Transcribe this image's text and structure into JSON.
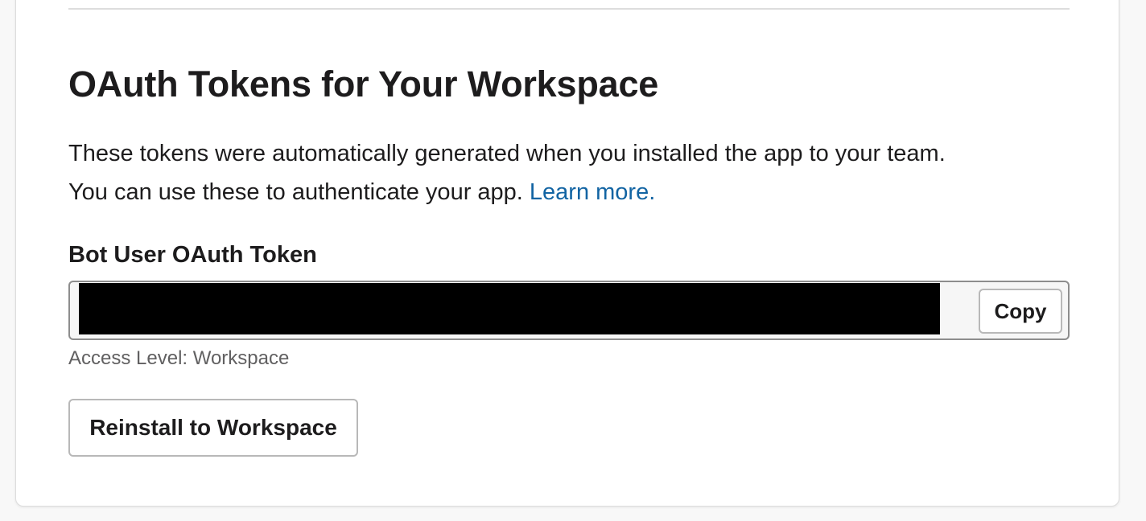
{
  "section": {
    "title": "OAuth Tokens for Your Workspace",
    "description_line1": "These tokens were automatically generated when you installed the app to your team.",
    "description_line2": "You can use these to authenticate your app.",
    "learn_more_label": "Learn more."
  },
  "token": {
    "label": "Bot User OAuth Token",
    "copy_label": "Copy",
    "access_level": "Access Level: Workspace"
  },
  "actions": {
    "reinstall_label": "Reinstall to Workspace"
  },
  "colors": {
    "link": "#1264a3",
    "text": "#1d1c1d",
    "muted": "#616061"
  }
}
